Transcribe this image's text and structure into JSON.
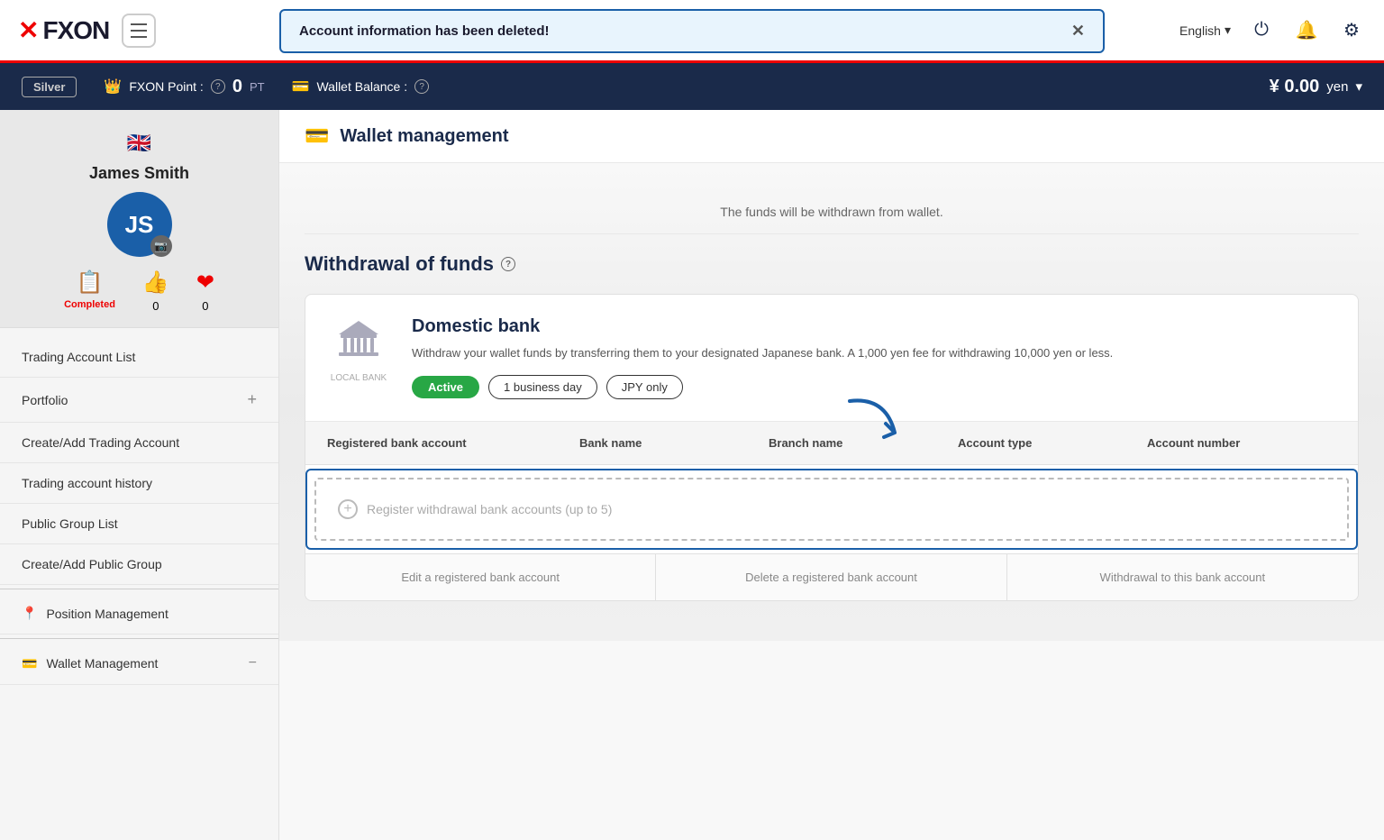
{
  "app": {
    "name": "FXON",
    "logo_x": "✕"
  },
  "notification": {
    "message": "Account information has been deleted!",
    "close_label": "✕"
  },
  "nav": {
    "lang": "English",
    "lang_chevron": "▾"
  },
  "points_bar": {
    "tier": "Silver",
    "fxon_point_label": "FXON Point :",
    "points_value": "0",
    "points_unit": "PT",
    "wallet_label": "Wallet Balance :",
    "wallet_amount": "¥ 0.00",
    "wallet_unit": "yen"
  },
  "sidebar": {
    "flag": "🇬🇧",
    "user_name": "James Smith",
    "avatar_initials": "JS",
    "stats": {
      "completed_label": "Completed",
      "likes_value": "0",
      "hearts_value": "0"
    },
    "menu": [
      {
        "label": "Trading Account List",
        "has_plus": false
      },
      {
        "label": "Portfolio",
        "has_plus": true
      },
      {
        "label": "Create/Add Trading Account",
        "has_plus": false
      },
      {
        "label": "Trading account history",
        "has_plus": false
      },
      {
        "label": "Public Group List",
        "has_plus": false
      },
      {
        "label": "Create/Add Public Group",
        "has_plus": false
      }
    ],
    "position_label": "Position Management",
    "wallet_label": "Wallet Management",
    "wallet_minus": "−"
  },
  "page": {
    "header_icon": "💳",
    "title": "Wallet management",
    "info_text": "The funds will be withdrawn from wallet.",
    "section_title": "Withdrawal of funds",
    "bank_card": {
      "icon_label": "LOCAL BANK",
      "bank_name": "Domestic bank",
      "description": "Withdraw your wallet funds by transferring them to your designated Japanese bank. A 1,000 yen fee for withdrawing 10,000 yen or less.",
      "status_active": "Active",
      "badge_days": "1 business day",
      "badge_currency": "JPY only",
      "table_headers": [
        "Registered bank account",
        "Bank name",
        "Branch name",
        "Account type",
        "Account number"
      ],
      "register_placeholder": "Register withdrawal bank accounts (up to 5)",
      "action_edit": "Edit a registered bank account",
      "action_delete": "Delete a registered bank account",
      "action_withdraw": "Withdrawal to this bank account"
    }
  }
}
